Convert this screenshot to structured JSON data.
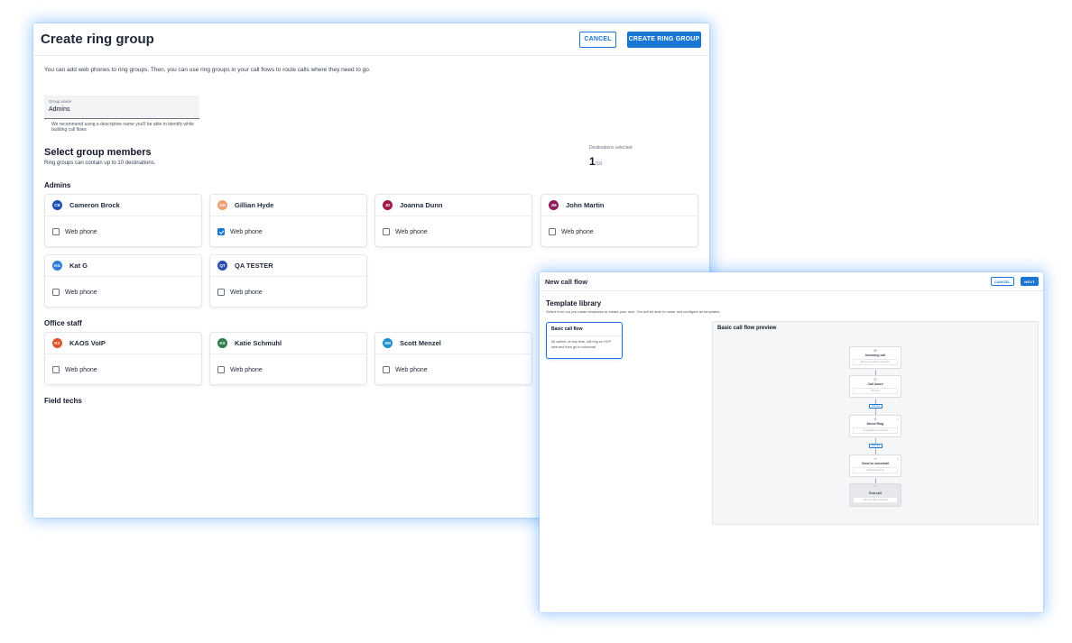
{
  "ring_group": {
    "title": "Create ring group",
    "cancel": "CANCEL",
    "create": "CREATE RING GROUP",
    "intro": "You can add web phones to ring groups. Then, you can use ring groups in your call flows to route calls where they need to go.",
    "group_name_label": "Group name",
    "group_name_value": "Admins",
    "group_name_help": "We recommend using a descriptive name you'll be able to identify while building call flows",
    "members_title": "Select group members",
    "members_sub": "Ring groups can contain up to 10 destinations.",
    "destinations_label": "Destinations selected",
    "destinations_count": "1",
    "destinations_max": "/10",
    "checkbox_label": "Web phone",
    "groups": [
      {
        "name": "Admins",
        "members": [
          {
            "initials": "CB",
            "name": "Cameron Brock",
            "color": "#1e4fb8",
            "checked": false
          },
          {
            "initials": "GH",
            "name": "Gillian Hyde",
            "color": "#f0a070",
            "checked": true
          },
          {
            "initials": "JD",
            "name": "Joanna Dunn",
            "color": "#a0174a",
            "checked": false
          },
          {
            "initials": "JM",
            "name": "John Martin",
            "color": "#8e1a5c",
            "checked": false
          },
          {
            "initials": "KG",
            "name": "Kat G",
            "color": "#2f7fd8",
            "checked": false
          },
          {
            "initials": "QT",
            "name": "QA TESTER",
            "color": "#2b4db0",
            "checked": false
          }
        ]
      },
      {
        "name": "Office staff",
        "members": [
          {
            "initials": "KV",
            "name": "KAOS VoIP",
            "color": "#e0532a",
            "checked": false
          },
          {
            "initials": "KS",
            "name": "Katie Schmuhl",
            "color": "#2e7d4a",
            "checked": false
          },
          {
            "initials": "SM",
            "name": "Scott Menzel",
            "color": "#1e90d0",
            "checked": false
          }
        ]
      },
      {
        "name": "Field techs",
        "members": []
      }
    ]
  },
  "call_flow": {
    "title": "New call flow",
    "cancel": "CANCEL",
    "next": "NEXT",
    "library_title": "Template library",
    "library_sub": "Select from our pre-made templates or create your own. You will be able to name and configure all templates.",
    "template_name": "Basic call flow",
    "template_desc": "All callers, at any time, will ring on HCP web and then go to voicemail",
    "preview_title": "Basic call flow preview",
    "nodes": [
      {
        "title": "Incoming call",
        "box": "Business numbers assigned",
        "icon": "phone-icon"
      },
      {
        "title": "Call hours",
        "box": "24 hours",
        "icon": "clock-icon"
      },
      {
        "title": "Direct Ring",
        "box": "All available web phones",
        "icon": "ring-icon"
      },
      {
        "title": "Send to voicemail",
        "box": "Default voicemail",
        "icon": "voicemail-icon"
      },
      {
        "title": "End call",
        "box": "Call ends after voicemail",
        "icon": "end-icon"
      }
    ],
    "add_step": "add step"
  }
}
